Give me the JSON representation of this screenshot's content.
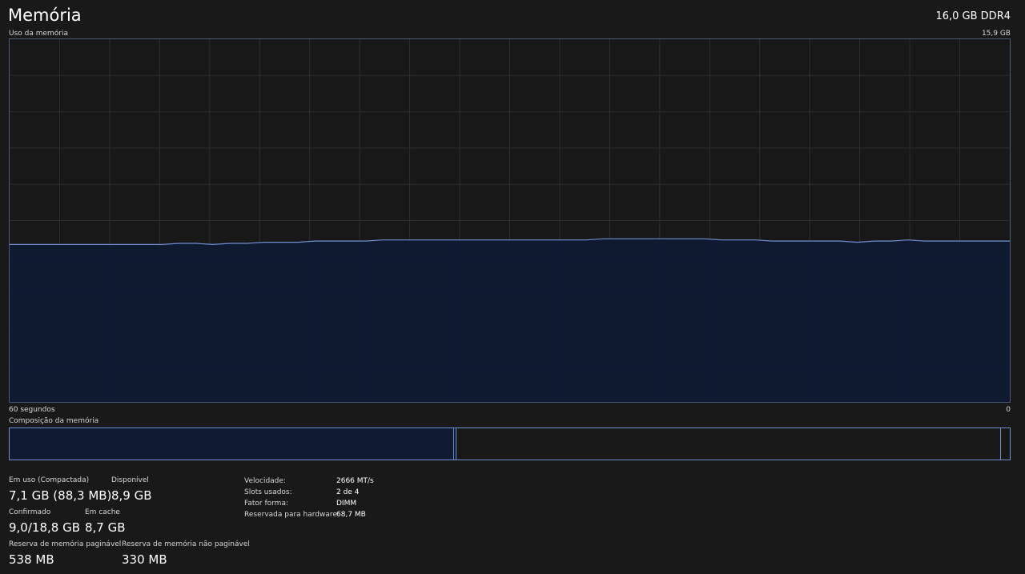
{
  "header": {
    "title": "Memória",
    "memory_type": "16,0 GB DDR4"
  },
  "graph": {
    "label": "Uso da memória",
    "max_label": "15,9 GB",
    "time_left_label": "60 segundos",
    "time_right_label": "0",
    "line_color": "#6f8fcf",
    "fill_color": "#0f1a33",
    "grid_color": "#2e2e2e",
    "max_gb": 15.9,
    "usage_gb": [
      6.9,
      6.9,
      6.9,
      6.9,
      6.9,
      6.9,
      6.9,
      6.9,
      6.9,
      6.9,
      6.95,
      6.95,
      6.9,
      6.95,
      6.95,
      7.0,
      7.0,
      7.0,
      7.05,
      7.05,
      7.05,
      7.05,
      7.1,
      7.1,
      7.1,
      7.1,
      7.1,
      7.1,
      7.1,
      7.1,
      7.1,
      7.1,
      7.1,
      7.1,
      7.1,
      7.15,
      7.15,
      7.15,
      7.15,
      7.15,
      7.15,
      7.15,
      7.1,
      7.1,
      7.1,
      7.05,
      7.05,
      7.05,
      7.05,
      7.05,
      7.0,
      7.05,
      7.05,
      7.1,
      7.05,
      7.05,
      7.05,
      7.05,
      7.05,
      7.05
    ]
  },
  "composition": {
    "label": "Composição da memória"
  },
  "stats": {
    "in_use_label": "Em uso (Compactada)",
    "in_use_value": "7,1 GB (88,3 MB)",
    "available_label": "Disponível",
    "available_value": "8,9 GB",
    "committed_label": "Confirmado",
    "committed_value": "9,0/18,8 GB",
    "cached_label": "Em cache",
    "cached_value": "8,7 GB",
    "paged_pool_label": "Reserva de memória paginável",
    "paged_pool_value": "538 MB",
    "nonpaged_pool_label": "Reserva de memória não paginável",
    "nonpaged_pool_value": "330 MB"
  },
  "properties": [
    {
      "key": "Velocidade:",
      "value": "2666 MT/s"
    },
    {
      "key": "Slots usados:",
      "value": "2 de 4"
    },
    {
      "key": "Fator forma:",
      "value": "DIMM"
    },
    {
      "key": "Reservada para hardware:",
      "value": "68,7 MB"
    }
  ]
}
